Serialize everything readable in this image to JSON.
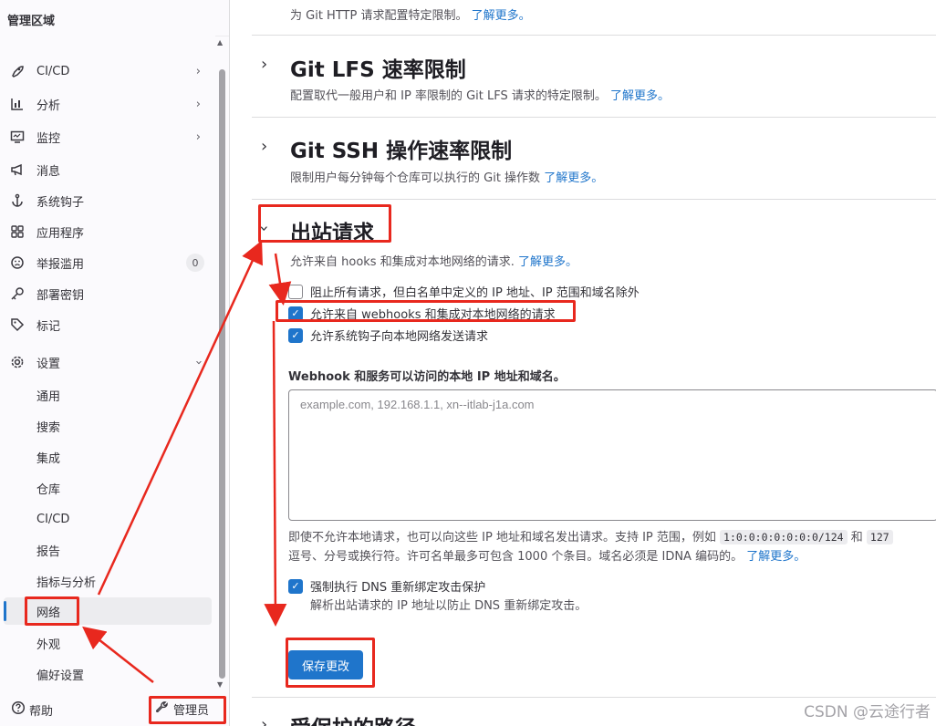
{
  "sidebar": {
    "title": "管理区域",
    "items": [
      {
        "label": "CI/CD",
        "icon": "rocket-icon",
        "chevron": true
      },
      {
        "label": "分析",
        "icon": "chart-icon",
        "chevron": true
      },
      {
        "label": "监控",
        "icon": "monitor-icon",
        "chevron": true
      },
      {
        "label": "消息",
        "icon": "bullhorn-icon"
      },
      {
        "label": "系统钩子",
        "icon": "anchor-icon"
      },
      {
        "label": "应用程序",
        "icon": "applications-icon"
      },
      {
        "label": "举报滥用",
        "icon": "abuse-icon",
        "badge": "0"
      },
      {
        "label": "部署密钥",
        "icon": "key-icon"
      },
      {
        "label": "标记",
        "icon": "label-icon"
      },
      {
        "label": "设置",
        "icon": "settings-icon",
        "chevron": true
      }
    ],
    "settings_sub": [
      "通用",
      "搜索",
      "集成",
      "仓库",
      "CI/CD",
      "报告",
      "指标与分析",
      "网络",
      "外观",
      "偏好设置"
    ],
    "active_sub": "网络",
    "footer": {
      "help": "帮助",
      "admin": "管理员"
    }
  },
  "main": {
    "top_desc": "为 Git HTTP 请求配置特定限制。",
    "top_link": "了解更多。",
    "sections": [
      {
        "title": "Git LFS 速率限制",
        "desc": "配置取代一般用户和 IP 率限制的 Git LFS 请求的特定限制。",
        "link": "了解更多。"
      },
      {
        "title": "Git SSH 操作速率限制",
        "desc": "限制用户每分钟每个仓库可以执行的 Git 操作数",
        "link": "了解更多。"
      },
      {
        "title": "出站请求",
        "desc": "允许来自 hooks 和集成对本地网络的请求.",
        "link": "了解更多。"
      }
    ],
    "checkboxes": [
      {
        "label": "阻止所有请求，但白名单中定义的 IP 地址、IP 范围和域名除外",
        "checked": false
      },
      {
        "label": "允许来自 webhooks 和集成对本地网络的请求",
        "checked": true
      },
      {
        "label": "允许系统钩子向本地网络发送请求",
        "checked": true
      }
    ],
    "allowlist_label": "Webhook 和服务可以访问的本地 IP 地址和域名。",
    "allowlist_placeholder": "example.com, 192.168.1.1, xn--itlab-j1a.com",
    "help_line1_a": "即使不允许本地请求，也可以向这些 IP 地址和域名发出请求。支持 IP 范围，例如",
    "help_code1": "1:0:0:0:0:0:0:0/124",
    "help_and": "和",
    "help_code2": "127",
    "help_line2": "逗号、分号或换行符。许可名单最多可包含 1000 个条目。域名必须是 IDNA 编码的。",
    "help_link": "了解更多。",
    "dns_label": "强制执行 DNS 重新绑定攻击保护",
    "dns_checked": true,
    "dns_desc": "解析出站请求的 IP 地址以防止 DNS 重新绑定攻击。",
    "save_label": "保存更改",
    "next_section_title": "受保护的路径"
  },
  "watermark": "CSDN @云途行者",
  "colors": {
    "accent": "#1f75cb",
    "annotation": "#e8281e"
  }
}
